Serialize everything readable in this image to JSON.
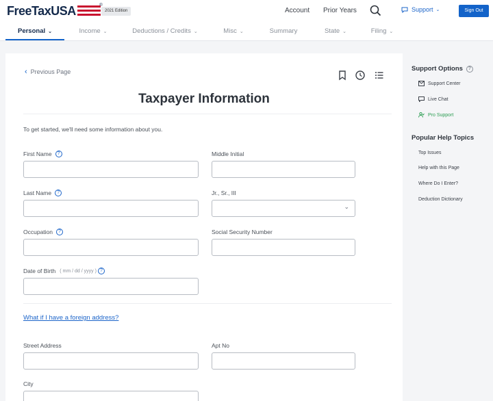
{
  "header": {
    "logo_text": "FreeTaxUSA",
    "logo_mark": "®",
    "edition": "2021 Edition",
    "account": "Account",
    "prior_years": "Prior Years",
    "support": "Support",
    "sign_out": "Sign Out"
  },
  "nav": {
    "tabs": [
      {
        "label": "Personal",
        "active": true
      },
      {
        "label": "Income"
      },
      {
        "label": "Deductions / Credits"
      },
      {
        "label": "Misc"
      },
      {
        "label": "Summary"
      },
      {
        "label": "State"
      },
      {
        "label": "Filing"
      }
    ]
  },
  "page": {
    "previous": "Previous Page",
    "title": "Taxpayer Information",
    "intro": "To get started, we'll need some information about you.",
    "fields": {
      "first_name": "First Name",
      "middle_initial": "Middle Initial",
      "last_name": "Last Name",
      "suffix": "Jr., Sr., III",
      "occupation": "Occupation",
      "ssn": "Social Security Number",
      "dob": "Date of Birth",
      "dob_hint": "( mm / dd / yyyy )",
      "street": "Street Address",
      "apt": "Apt No",
      "city": "City"
    },
    "foreign_link": "What if I have a foreign address?"
  },
  "sidebar": {
    "support_title": "Support Options",
    "support_links": [
      "Support Center",
      "Live Chat",
      "Pro Support"
    ],
    "help_title": "Popular Help Topics",
    "help_topics": [
      "Top Issues",
      "Help with this Page",
      "Where Do I Enter?",
      "Deduction Dictionary"
    ]
  },
  "colors": {
    "brand_navy": "#13294b",
    "brand_red": "#c8102e",
    "accent_blue": "#1363c9",
    "pro_green": "#2e9e54"
  }
}
